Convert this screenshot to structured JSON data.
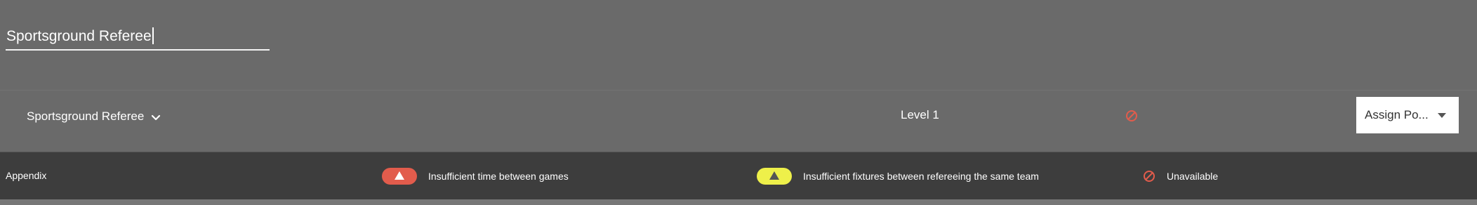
{
  "header": {
    "title_input_value": "Sportsground Referee"
  },
  "assignment_row": {
    "role_label": "Sportsground Referee",
    "level_label": "Level 1",
    "assign_button_label": "Assign Po..."
  },
  "appendix": {
    "label": "Appendix",
    "legend": [
      {
        "label": "Insufficient time between games",
        "color": "#e25c4c",
        "icon": "warning-triangle-icon"
      },
      {
        "label": "Insufficient fixtures between refereeing the same team",
        "color": "#eef04a",
        "icon": "warning-triangle-icon"
      },
      {
        "label": "Unavailable",
        "color": "#e25c4c",
        "icon": "unavailable-icon"
      }
    ]
  },
  "colors": {
    "page_background": "#6a6a6a",
    "appendix_background": "#3d3d3d",
    "danger": "#e25c4c",
    "warning": "#eef04a"
  }
}
